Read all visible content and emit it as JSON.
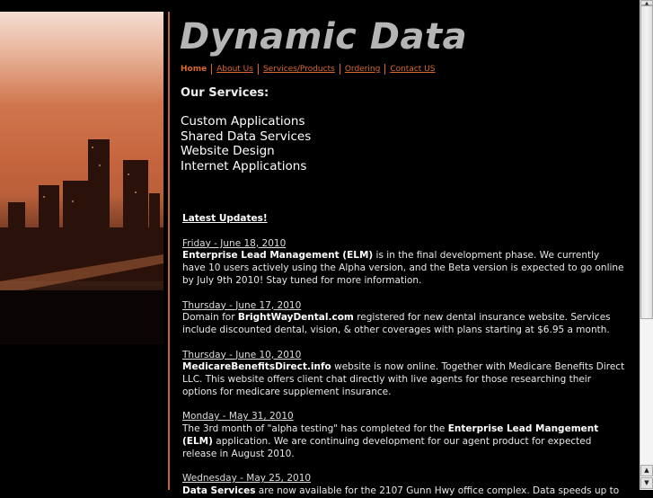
{
  "header": {
    "title": "Dynamic Data"
  },
  "nav": [
    {
      "label": "Home"
    },
    {
      "label": "About Us"
    },
    {
      "label": "Services/Products"
    },
    {
      "label": "Ordering"
    },
    {
      "label": "Contact US"
    }
  ],
  "services": {
    "heading": "Our Services:",
    "items": [
      "Custom Applications",
      "Shared Data Services",
      "Website Design",
      "Internet Applications"
    ]
  },
  "updates": {
    "heading": "Latest Updates!",
    "entries": [
      {
        "date": "Friday - June 18, 2010",
        "bold": "Enterprise Lead Management (ELM)",
        "text": " is in the final development phase.  We currently have 10 users actively using the Alpha version, and the Beta version is expected to go online by July 9th 2010!  Stay tuned for more information."
      },
      {
        "date": "Thursday - June 17, 2010",
        "pre": "Domain for ",
        "bold": "BrightWayDental.com",
        "text": " registered for new dental insurance website.  Services include discounted dental, vision, & other coverages with plans starting at $6.95 a month."
      },
      {
        "date": "Thursday - June 10, 2010",
        "bold": "MedicareBenefitsDirect.info",
        "text": " website is now online.  Together with Medicare Benefits Direct LLC.  This website offers client chat directly with live agents for those researching their options for medicare supplement insurance."
      },
      {
        "date": "Monday - May 31, 2010",
        "pre": "The 3rd month of \"alpha testing\" has completed for the ",
        "bold": "Enterprise Lead Mangement (ELM)",
        "text": " application.  We are continuing development for our agent product for expected release in August 2010."
      },
      {
        "date": "Wednesday - May 25, 2010",
        "bold": "Data Services",
        "text": " are now available for the 2107 Gunn Hwy office complex.  Data speeds up to"
      }
    ]
  },
  "colors": {
    "accent": "#d9692c",
    "background": "#000000",
    "title": "#b5b5b5"
  }
}
